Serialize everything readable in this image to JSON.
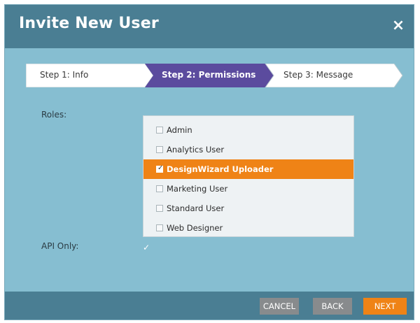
{
  "dialog": {
    "title": "Invite New User",
    "close_symbol": "×"
  },
  "steps": [
    {
      "label": "Step 1: Info",
      "active": false
    },
    {
      "label": "Step 2: Permissions",
      "active": true
    },
    {
      "label": "Step 3: Message",
      "active": false
    }
  ],
  "form": {
    "roles_label": "Roles:",
    "roles": [
      {
        "label": "Admin",
        "checked": false,
        "selected": false
      },
      {
        "label": "Analytics User",
        "checked": false,
        "selected": false
      },
      {
        "label": "DesignWizard Uploader",
        "checked": true,
        "selected": true
      },
      {
        "label": "Marketing User",
        "checked": false,
        "selected": false
      },
      {
        "label": "Standard User",
        "checked": false,
        "selected": false
      },
      {
        "label": "Web Designer",
        "checked": false,
        "selected": false
      }
    ],
    "api_only_label": "API Only:",
    "api_only_checked": true
  },
  "footer": {
    "cancel_label": "CANCEL",
    "back_label": "BACK",
    "next_label": "NEXT"
  },
  "colors": {
    "body_bg": "#86bed1",
    "bar_bg": "#4a7e93",
    "active_step": "#5b4b9e",
    "accent_orange": "#ef8316",
    "button_gray": "#888b8d"
  }
}
